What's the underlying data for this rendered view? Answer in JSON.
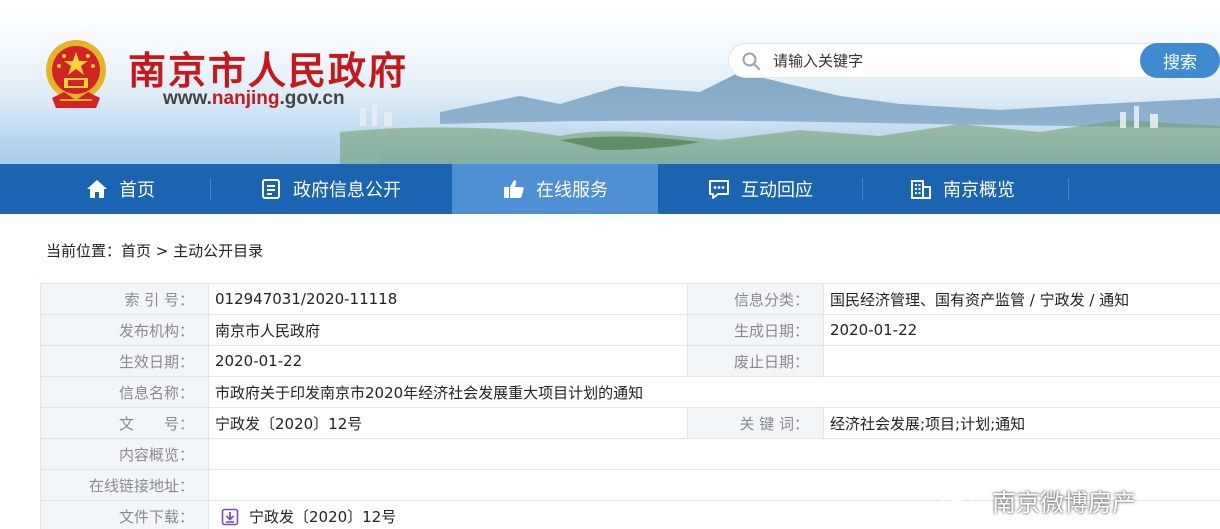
{
  "header": {
    "site_title": "南京市人民政府",
    "url_prefix": "www.",
    "url_highlight": "nanjing",
    "url_suffix": ".gov.cn",
    "search_placeholder": "请输入关键字",
    "search_button": "搜索",
    "emblem_icon": "national-emblem-icon"
  },
  "nav": {
    "items": [
      {
        "label": "首页",
        "icon": "home-icon"
      },
      {
        "label": "政府信息公开",
        "icon": "document-icon"
      },
      {
        "label": "在线服务",
        "icon": "thumbs-up-icon",
        "active": true
      },
      {
        "label": "互动回应",
        "icon": "chat-icon"
      },
      {
        "label": "南京概览",
        "icon": "building-icon"
      }
    ]
  },
  "breadcrumb": {
    "prefix": "当前位置：",
    "home": "首页",
    "separator": " > ",
    "current": "主动公开目录"
  },
  "info": {
    "index_label": "索 引 号：",
    "index_value": "012947031/2020-11118",
    "category_label": "信息分类：",
    "category_value": "国民经济管理、国有资产监管 / 宁政发 / 通知",
    "publisher_label": "发布机构：",
    "publisher_value": "南京市人民政府",
    "created_label": "生成日期：",
    "created_value": "2020-01-22",
    "effective_label": "生效日期：",
    "effective_value": "2020-01-22",
    "abolished_label": "废止日期：",
    "abolished_value": "",
    "name_label": "信息名称：",
    "name_value": "市政府关于印发南京市2020年经济社会发展重大项目计划的通知",
    "docno_label": "文　　号：",
    "docno_value": "宁政发〔2020〕12号",
    "keywords_label": "关 键 词：",
    "keywords_value": "经济社会发展;项目;计划;通知",
    "summary_label": "内容概览：",
    "summary_value": "",
    "link_label": "在线链接地址：",
    "link_value": "",
    "download_label": "文件下载：",
    "download_value": "宁政发〔2020〕12号"
  },
  "watermark": {
    "text": "南京微博房产"
  },
  "colors": {
    "brand_red": "#c5181c",
    "nav_blue": "#1a64b1",
    "nav_active": "#4f8fd3",
    "search_button": "#3f8ad0",
    "label_bg": "#f3f6f9",
    "download_icon": "#7b4bd6"
  }
}
